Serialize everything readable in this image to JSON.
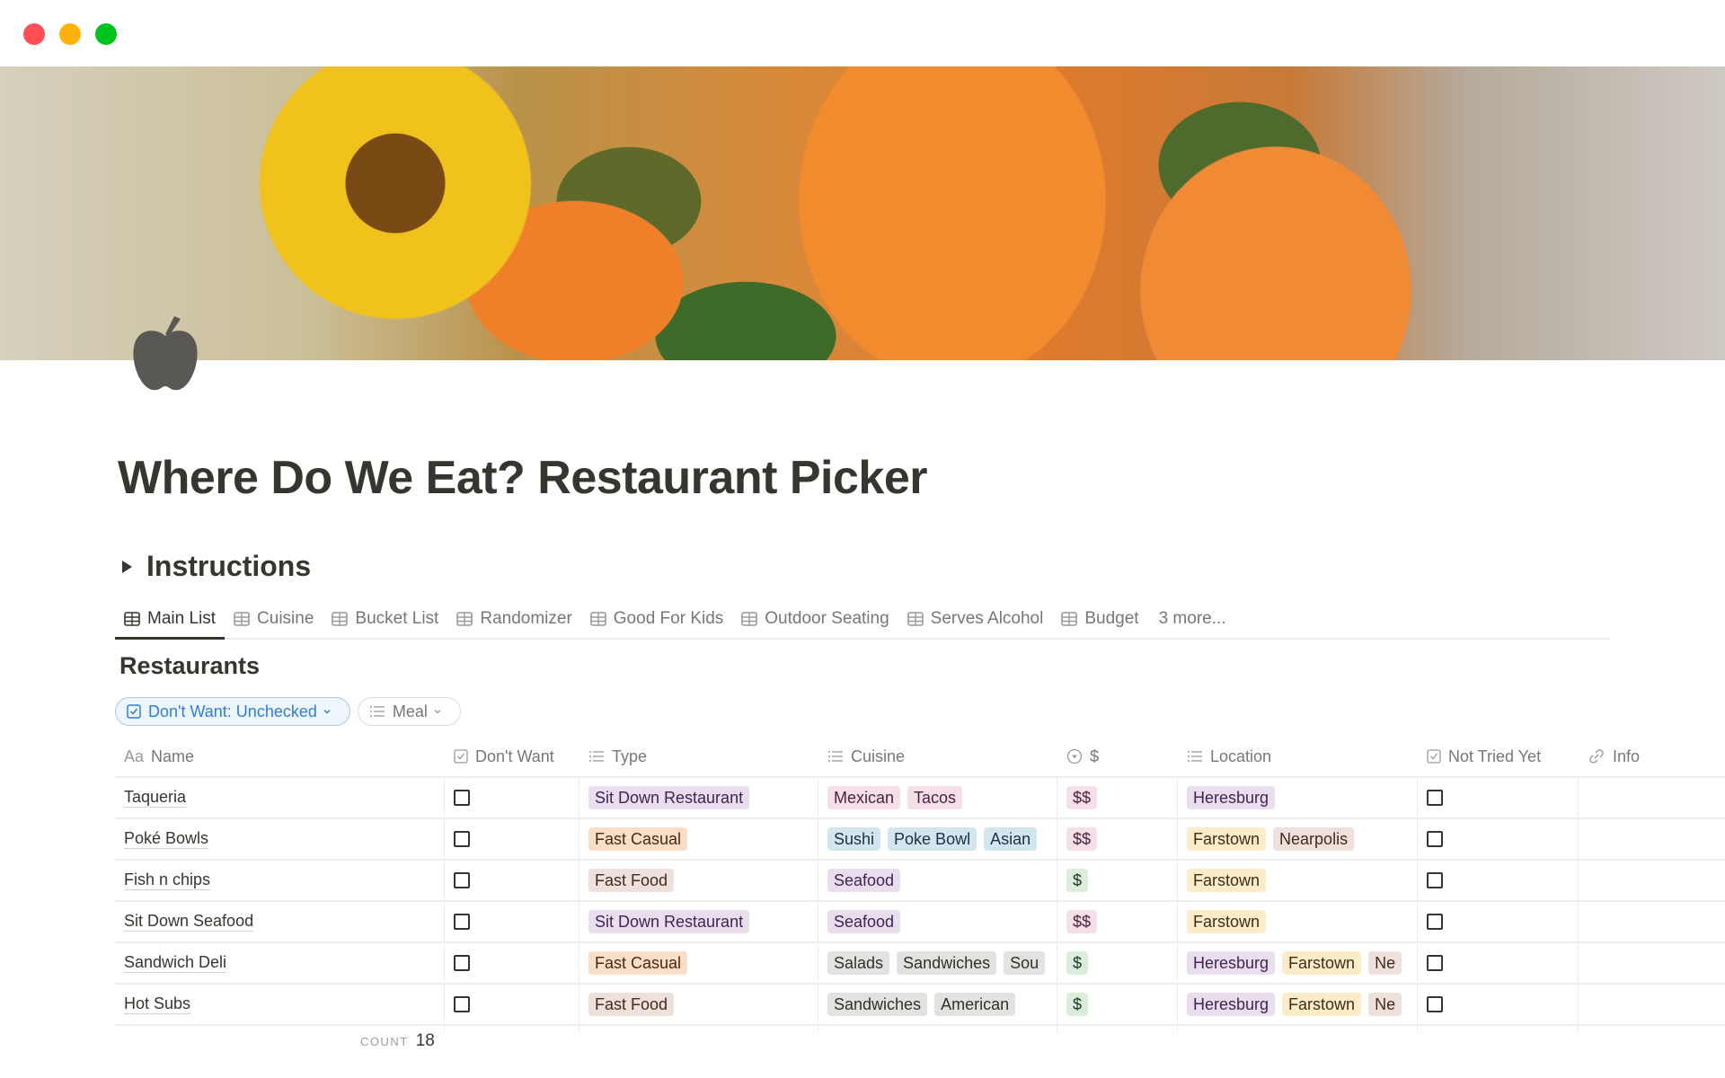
{
  "window": {
    "controls": [
      {
        "name": "close",
        "color": "#ff4f55"
      },
      {
        "name": "minimize",
        "color": "#ffb20b"
      },
      {
        "name": "maximize",
        "color": "#00c41e"
      }
    ]
  },
  "page": {
    "icon": "apple-icon",
    "title": "Where Do We Eat? Restaurant Picker"
  },
  "instructions": {
    "label": "Instructions"
  },
  "tabs": [
    {
      "label": "Main List",
      "active": true
    },
    {
      "label": "Cuisine"
    },
    {
      "label": "Bucket List"
    },
    {
      "label": "Randomizer"
    },
    {
      "label": "Good For Kids"
    },
    {
      "label": "Outdoor Seating"
    },
    {
      "label": "Serves Alcohol"
    },
    {
      "label": "Budget"
    }
  ],
  "tabs_more": "3 more...",
  "database": {
    "title": "Restaurants"
  },
  "filters": [
    {
      "label": "Don't Want: Unchecked",
      "icon": "checkbox-icon",
      "active": true
    },
    {
      "label": "Meal",
      "icon": "list-icon",
      "active": false
    }
  ],
  "columns": [
    {
      "label": "Name",
      "icon": "Aa"
    },
    {
      "label": "Don't Want",
      "icon": "checkbox-icon"
    },
    {
      "label": "Type",
      "icon": "list-icon"
    },
    {
      "label": "Cuisine",
      "icon": "list-icon"
    },
    {
      "label": "$",
      "icon": "select-icon"
    },
    {
      "label": "Location",
      "icon": "list-icon"
    },
    {
      "label": "Not Tried Yet",
      "icon": "checkbox-icon"
    },
    {
      "label": "Info",
      "icon": "link-icon"
    }
  ],
  "tag_colors": {
    "purple": {
      "bg": "#e8deee",
      "fg": "#412454"
    },
    "orange": {
      "bg": "#fadec9",
      "fg": "#49290e"
    },
    "brown": {
      "bg": "#eee0da",
      "fg": "#442a1e"
    },
    "pink": {
      "bg": "#f5e0e9",
      "fg": "#4c2337"
    },
    "blue": {
      "bg": "#d3e5ef",
      "fg": "#183347"
    },
    "gray": {
      "bg": "#e3e2e0",
      "fg": "#32302c"
    },
    "green": {
      "bg": "#dbeddb",
      "fg": "#1c3829"
    },
    "yellow": {
      "bg": "#fdecc8",
      "fg": "#402c1b"
    }
  },
  "rows": [
    {
      "name": "Taqueria",
      "dont_want": false,
      "type": [
        {
          "label": "Sit Down Restaurant",
          "color": "purple"
        }
      ],
      "cuisine": [
        {
          "label": "Mexican",
          "color": "pink"
        },
        {
          "label": "Tacos",
          "color": "pink"
        }
      ],
      "price": {
        "label": "$$",
        "color": "pink"
      },
      "location": [
        {
          "label": "Heresburg",
          "color": "purple"
        }
      ],
      "not_tried": false,
      "info": ""
    },
    {
      "name": "Poké Bowls",
      "dont_want": false,
      "type": [
        {
          "label": "Fast Casual",
          "color": "orange"
        }
      ],
      "cuisine": [
        {
          "label": "Sushi",
          "color": "blue"
        },
        {
          "label": "Poke Bowl",
          "color": "blue"
        },
        {
          "label": "Asian",
          "color": "blue"
        }
      ],
      "price": {
        "label": "$$",
        "color": "pink"
      },
      "location": [
        {
          "label": "Farstown",
          "color": "yellow"
        },
        {
          "label": "Nearpolis",
          "color": "brown"
        }
      ],
      "not_tried": false,
      "info": ""
    },
    {
      "name": "Fish n chips",
      "dont_want": false,
      "type": [
        {
          "label": "Fast Food",
          "color": "brown"
        }
      ],
      "cuisine": [
        {
          "label": "Seafood",
          "color": "purple"
        }
      ],
      "price": {
        "label": "$",
        "color": "green"
      },
      "location": [
        {
          "label": "Farstown",
          "color": "yellow"
        }
      ],
      "not_tried": false,
      "info": ""
    },
    {
      "name": "Sit Down Seafood",
      "dont_want": false,
      "type": [
        {
          "label": "Sit Down Restaurant",
          "color": "purple"
        }
      ],
      "cuisine": [
        {
          "label": "Seafood",
          "color": "purple"
        }
      ],
      "price": {
        "label": "$$",
        "color": "pink"
      },
      "location": [
        {
          "label": "Farstown",
          "color": "yellow"
        }
      ],
      "not_tried": false,
      "info": ""
    },
    {
      "name": "Sandwich Deli",
      "dont_want": false,
      "type": [
        {
          "label": "Fast Casual",
          "color": "orange"
        }
      ],
      "cuisine": [
        {
          "label": "Salads",
          "color": "gray"
        },
        {
          "label": "Sandwiches",
          "color": "gray"
        },
        {
          "label": "Sou",
          "color": "gray"
        }
      ],
      "price": {
        "label": "$",
        "color": "green"
      },
      "location": [
        {
          "label": "Heresburg",
          "color": "purple"
        },
        {
          "label": "Farstown",
          "color": "yellow"
        },
        {
          "label": "Ne",
          "color": "brown"
        }
      ],
      "not_tried": false,
      "info": ""
    },
    {
      "name": "Hot Subs",
      "dont_want": false,
      "type": [
        {
          "label": "Fast Food",
          "color": "brown"
        }
      ],
      "cuisine": [
        {
          "label": "Sandwiches",
          "color": "gray"
        },
        {
          "label": "American",
          "color": "gray"
        }
      ],
      "price": {
        "label": "$",
        "color": "green"
      },
      "location": [
        {
          "label": "Heresburg",
          "color": "purple"
        },
        {
          "label": "Farstown",
          "color": "yellow"
        },
        {
          "label": "Ne",
          "color": "brown"
        }
      ],
      "not_tried": false,
      "info": ""
    }
  ],
  "footer": {
    "count_label": "COUNT",
    "count_value": "18"
  }
}
